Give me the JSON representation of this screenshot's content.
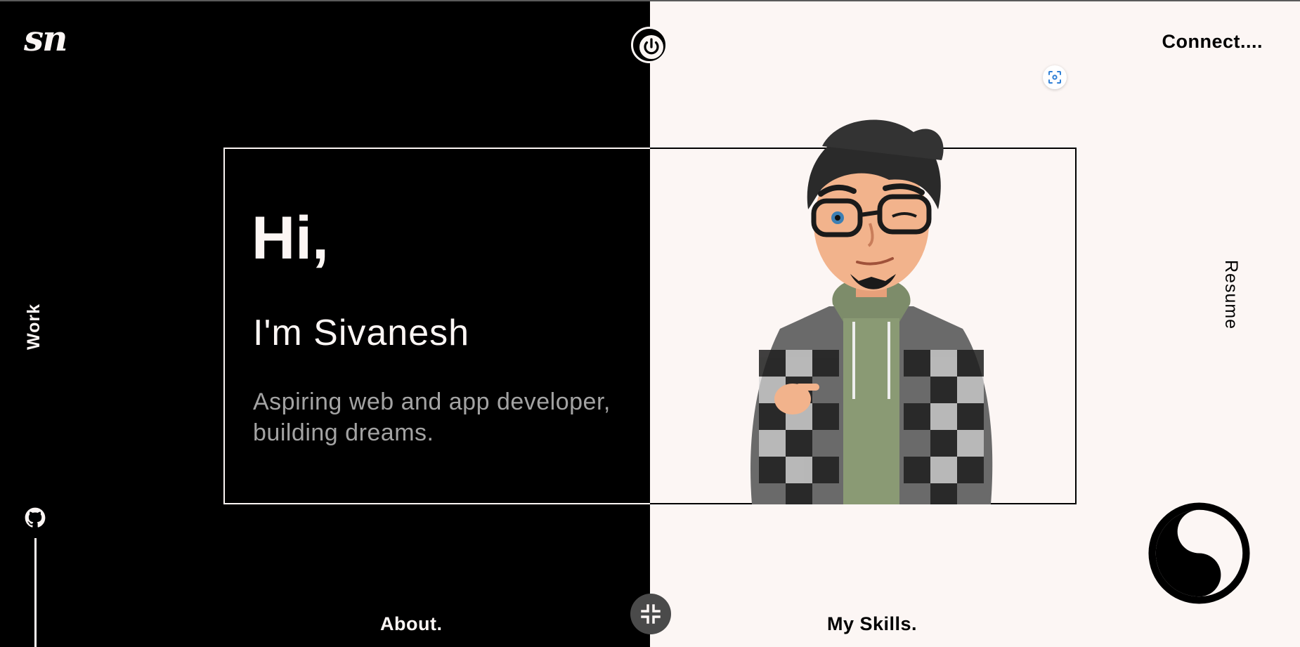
{
  "header": {
    "logo_text": "sn",
    "connect_label": "Connect...."
  },
  "hero": {
    "greeting": "Hi,",
    "intro": "I'm Sivanesh",
    "tagline": "Aspiring web and app developer, building dreams."
  },
  "nav": {
    "work_label": "Work",
    "resume_label": "Resume",
    "about_label": "About.",
    "skills_label": "My Skills."
  },
  "icons": {
    "power": "power-icon",
    "scan": "scan-icon",
    "github": "github-icon",
    "collapse": "collapse-icon",
    "theme": "yin-yang-icon"
  },
  "colors": {
    "dark_bg": "#000000",
    "light_bg": "#fcf6f4",
    "tagline_gray": "#a3a3a3",
    "button_gray": "#4a4a4a",
    "scan_blue": "#2f7fd6"
  }
}
